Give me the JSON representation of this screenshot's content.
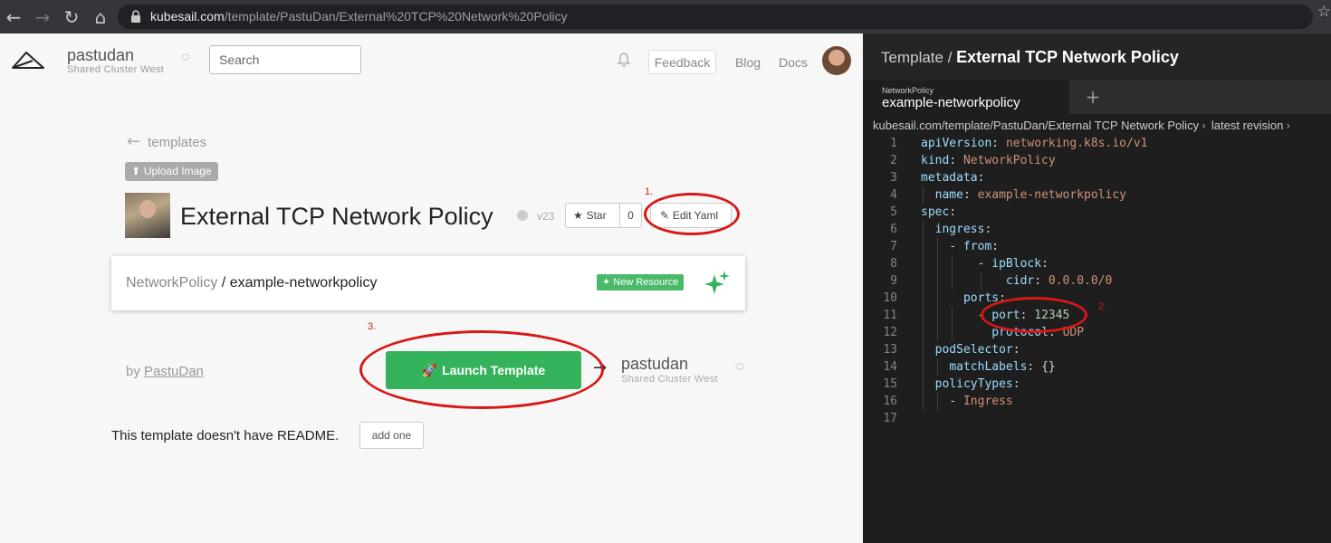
{
  "browser": {
    "url_host": "kubesail.com",
    "url_path": "/template/PastuDan/External%20TCP%20Network%20Policy"
  },
  "header": {
    "cluster_name": "pastudan",
    "cluster_sub": "Shared Cluster West",
    "search_placeholder": "Search",
    "feedback": "Feedback",
    "blog": "Blog",
    "docs": "Docs"
  },
  "template": {
    "back_label": "templates",
    "upload_label": "Upload Image",
    "title": "External TCP Network Policy",
    "version": "v23",
    "star_label": "Star",
    "star_count": "0",
    "edit_yaml": "Edit Yaml",
    "resource_kind": "NetworkPolicy",
    "resource_sep": " / ",
    "resource_name": "example-networkpolicy",
    "new_resource": "New Resource",
    "by_label": "by ",
    "author": "PastuDan",
    "launch_label": "Launch Template",
    "launch_cluster": "pastudan",
    "launch_cluster_sub": "Shared Cluster West",
    "readme_text": "This template doesn't have README.",
    "add_one": "add one"
  },
  "annotations": [
    "1.",
    "2.",
    "3."
  ],
  "editor": {
    "header_prefix": "Template / ",
    "header_title": "External TCP Network Policy",
    "tab_kind": "NetworkPolicy",
    "tab_name": "example-networkpolicy",
    "tab_add": "+",
    "breadcrumb_path": "kubesail.com/template/PastuDan/External TCP Network Policy",
    "breadcrumb_revision": "latest revision",
    "line_numbers": [
      "1",
      "2",
      "3",
      "4",
      "5",
      "6",
      "7",
      "8",
      "9",
      "10",
      "11",
      "12",
      "13",
      "14",
      "15",
      "16",
      "17"
    ],
    "yaml": {
      "apiVersion_key": "apiVersion",
      "apiVersion_val": "networking.k8s.io/v1",
      "kind_key": "kind",
      "kind_val": "NetworkPolicy",
      "metadata_key": "metadata",
      "name_key": "name",
      "name_val": "example-networkpolicy",
      "spec_key": "spec",
      "ingress_key": "ingress",
      "from_key": "from",
      "ipBlock_key": "ipBlock",
      "cidr_key": "cidr",
      "cidr_val": "0.0.0.0/0",
      "ports_key": "ports",
      "port_key": "port",
      "port_val": "12345",
      "protocol_key": "protocol",
      "protocol_val": "UDP",
      "podSelector_key": "podSelector",
      "matchLabels_key": "matchLabels",
      "matchLabels_val": "{}",
      "policyTypes_key": "policyTypes",
      "policyTypes_val": "Ingress"
    }
  },
  "colors": {
    "launch_green": "#35b35a",
    "annotation_red": "#d81818",
    "editor_bg": "#1e1e1e",
    "yaml_key": "#9cdcfe",
    "yaml_string": "#ce9178",
    "yaml_number": "#b5cea8"
  }
}
